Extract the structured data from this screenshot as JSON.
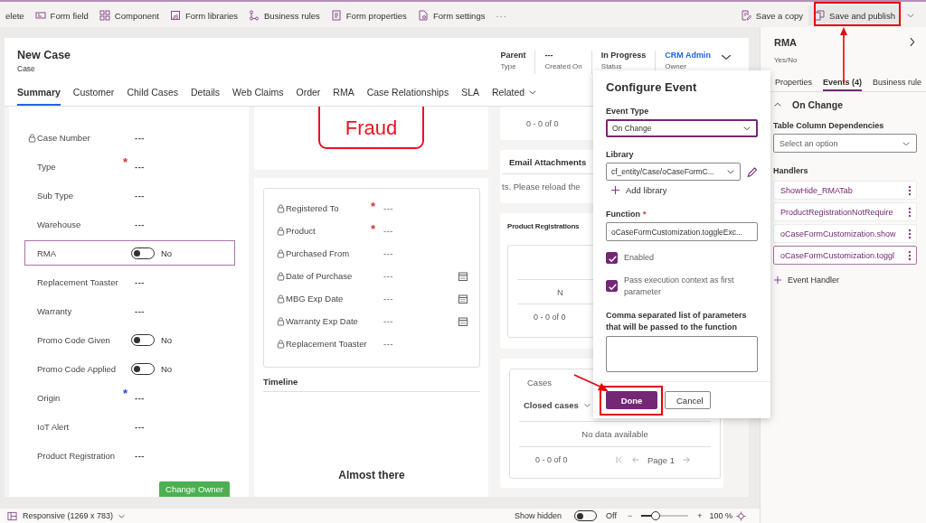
{
  "toolbar": {
    "items": [
      {
        "label": "elete"
      },
      {
        "label": "Form field"
      },
      {
        "label": "Component"
      },
      {
        "label": "Form libraries"
      },
      {
        "label": "Business rules"
      },
      {
        "label": "Form properties"
      },
      {
        "label": "Form settings"
      }
    ],
    "more": "···",
    "actions": [
      {
        "label": "Save a copy"
      },
      {
        "label": "Save and publish"
      }
    ]
  },
  "form": {
    "title": "New Case",
    "entity": "Case",
    "header_fields": [
      {
        "value": "Parent",
        "label": "Type",
        "kind": "text"
      },
      {
        "value": "---",
        "label": "Created On",
        "kind": "text"
      },
      {
        "value": "In Progress",
        "label": "Status",
        "kind": "text"
      },
      {
        "value": "CRM Admin",
        "label": "Owner",
        "kind": "link"
      }
    ],
    "tabs": [
      {
        "label": "Summary",
        "selected": true,
        "kind": "tab"
      },
      {
        "label": "Customer",
        "selected": false,
        "kind": "tab"
      },
      {
        "label": "Child Cases",
        "selected": false,
        "kind": "tab"
      },
      {
        "label": "Details",
        "selected": false,
        "kind": "tab"
      },
      {
        "label": "Web Claims",
        "selected": false,
        "kind": "tab"
      },
      {
        "label": "Order",
        "selected": false,
        "kind": "tab"
      },
      {
        "label": "RMA",
        "selected": false,
        "kind": "tab"
      },
      {
        "label": "Case Relationships",
        "selected": false,
        "kind": "tab"
      },
      {
        "label": "SLA",
        "selected": false,
        "kind": "tab"
      },
      {
        "label": "Related",
        "selected": false,
        "kind": "menu"
      }
    ],
    "summary_fields": [
      {
        "label": "Case Number",
        "locked": true,
        "kind": "text",
        "value": "---",
        "selected": false
      },
      {
        "label": "Type",
        "locked": false,
        "marker": "*",
        "color": "#d13438",
        "kind": "text",
        "value": "---",
        "selected": false
      },
      {
        "label": "Sub Type",
        "locked": false,
        "kind": "text",
        "value": "---",
        "selected": false
      },
      {
        "label": "Warehouse",
        "locked": false,
        "kind": "text",
        "value": "---",
        "selected": false
      },
      {
        "label": "RMA",
        "locked": false,
        "kind": "toggle",
        "on": false,
        "value": "No",
        "selected": true
      },
      {
        "label": "Replacement Toaster",
        "locked": false,
        "kind": "text",
        "value": "---",
        "selected": false
      },
      {
        "label": "Warranty",
        "locked": false,
        "kind": "text",
        "value": "---",
        "selected": false
      },
      {
        "label": "Promo Code Given",
        "locked": false,
        "kind": "toggle",
        "on": false,
        "value": "No",
        "selected": false
      },
      {
        "label": "Promo Code Applied",
        "locked": false,
        "kind": "toggle",
        "on": false,
        "value": "No",
        "selected": false
      },
      {
        "label": "Origin",
        "locked": false,
        "marker": "*",
        "color": "#2b3dd8",
        "kind": "text",
        "value": "---",
        "selected": false
      },
      {
        "label": "IoT Alert",
        "locked": false,
        "kind": "text",
        "value": "---",
        "selected": false
      },
      {
        "label": "Product Registration",
        "locked": false,
        "kind": "text",
        "value": "---",
        "selected": false
      }
    ],
    "summary_button": "Change Owner",
    "image": {
      "text": "Fraud"
    },
    "product_fields": [
      {
        "label": "Registered To",
        "locked": true,
        "marker": "*",
        "color": "#d13438",
        "kind": "text",
        "value": "---"
      },
      {
        "label": "Product",
        "locked": true,
        "marker": "*",
        "color": "#d13438",
        "kind": "text",
        "value": "---"
      },
      {
        "label": "Purchased From",
        "locked": true,
        "kind": "text",
        "value": "---"
      },
      {
        "label": "Date of Purchase",
        "locked": true,
        "kind": "date",
        "value": "---"
      },
      {
        "label": "MBG Exp Date",
        "locked": true,
        "kind": "date",
        "value": "---"
      },
      {
        "label": "Warranty Exp Date",
        "locked": true,
        "kind": "date",
        "value": "---"
      },
      {
        "label": "Replacement Toaster",
        "locked": true,
        "kind": "text",
        "value": "---"
      }
    ],
    "timeline": {
      "title": "Timeline",
      "message": "Almost there"
    },
    "subgrid_count": "0 - 0 of 0",
    "email_attachments": {
      "title": "Email Attachments",
      "message": "ts.  Please reload the"
    },
    "product_registrations": {
      "title": "Product Registrations",
      "message": "N",
      "count": "0 - 0 of 0"
    },
    "cases": {
      "title": "Cases",
      "view": "Closed cases",
      "message": "No data available",
      "count": "0 - 0 of 0",
      "page": "Page 1"
    }
  },
  "dialog": {
    "title": "Configure Event",
    "event_type": {
      "label": "Event Type",
      "value": "On Change",
      "focused": true
    },
    "library": {
      "label": "Library",
      "value": "cf_entity/Case/oCaseFormC...",
      "focused": false,
      "add": "Add library"
    },
    "function": {
      "label": "Function",
      "marker": "*",
      "value": "oCaseFormCustomization.toggleExc...",
      "focused": false
    },
    "checkboxes": [
      {
        "label": "Enabled",
        "checked": true
      },
      {
        "label": "Pass execution context as first parameter",
        "checked": true
      }
    ],
    "parameters": {
      "label": "Comma separated list of parameters that will be passed to the function"
    },
    "buttons": [
      {
        "label": "Done",
        "kind": "primary"
      },
      {
        "label": "Cancel",
        "kind": "secondary"
      }
    ]
  },
  "panel": {
    "title": "RMA",
    "subtitle": "Yes/No",
    "tabs": [
      {
        "label": "Properties",
        "selected": false
      },
      {
        "label": "Events (4)",
        "selected": true
      },
      {
        "label": "Business rule",
        "selected": false
      }
    ],
    "section": {
      "title": "On Change",
      "expanded": true
    },
    "dependencies": {
      "label": "Table Column Dependencies",
      "placeholder": "Select an option"
    },
    "handlers_label": "Handlers",
    "handlers": [
      {
        "label": "ShowHide_RMATab",
        "selected": false
      },
      {
        "label": "ProductRegistrationNotRequire",
        "selected": false
      },
      {
        "label": "oCaseFormCustomization.show",
        "selected": false
      },
      {
        "label": "oCaseFormCustomization.toggl",
        "selected": true
      }
    ],
    "add_handler": "Event Handler"
  },
  "status": {
    "layout": "Responsive (1269 x 783)",
    "show_hidden": {
      "label": "Show hidden",
      "on": false,
      "value": "Off"
    },
    "zoom": {
      "minus": "−",
      "plus": "+",
      "level": 0.3,
      "reading": "100 %"
    }
  }
}
